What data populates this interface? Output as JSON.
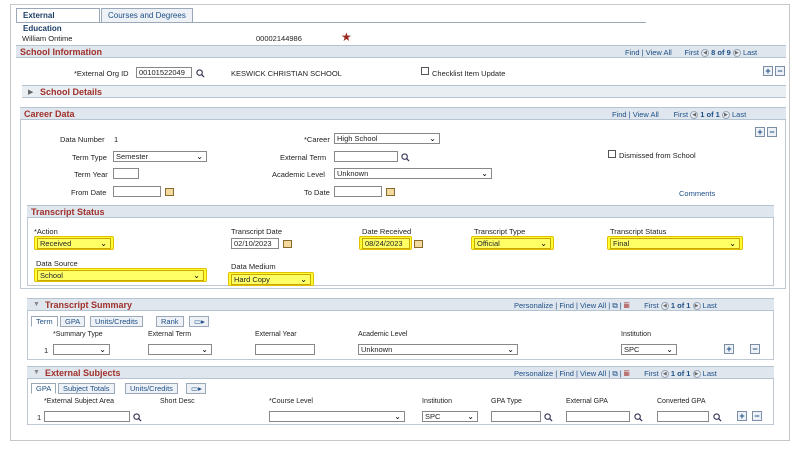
{
  "tabs": [
    {
      "label": "External Education",
      "active": true
    },
    {
      "label": "Courses and Degrees",
      "active": false
    }
  ],
  "person": {
    "name": "William Ontime",
    "id": "00002144986"
  },
  "school_info": {
    "title": "School Information",
    "nav": {
      "find": "Find",
      "view_all": "View All",
      "first": "First",
      "count": "8 of 9",
      "last": "Last"
    },
    "org_id_label": "*External Org ID",
    "org_id_value": "00101522049",
    "org_name": "KESWICK CHRISTIAN SCHOOL",
    "checklist_label": "Checklist Item Update",
    "details_label": "School Details"
  },
  "career": {
    "title": "Career Data",
    "nav": {
      "find": "Find",
      "view_all": "View All",
      "first": "First",
      "count": "1 of 1",
      "last": "Last"
    },
    "data_number_label": "Data Number",
    "data_number_value": "1",
    "career_label": "*Career",
    "career_value": "High School",
    "term_type_label": "Term Type",
    "term_type_value": "Semester",
    "external_term_label": "External Term",
    "dismissed_label": "Dismissed from School",
    "term_year_label": "Term Year",
    "academic_level_label": "Academic Level",
    "academic_level_value": "Unknown",
    "from_date_label": "From Date",
    "to_date_label": "To Date",
    "comments_label": "Comments"
  },
  "transcript_status": {
    "title": "Transcript Status",
    "action_label": "*Action",
    "action_value": "Received",
    "transcript_date_label": "Transcript Date",
    "transcript_date_value": "02/10/2023",
    "date_received_label": "Date Received",
    "date_received_value": "08/24/2023",
    "transcript_type_label": "Transcript Type",
    "transcript_type_value": "Official",
    "transcript_status_label": "Transcript Status",
    "transcript_status_value": "Final",
    "data_source_label": "Data Source",
    "data_source_value": "School",
    "data_medium_label": "Data Medium",
    "data_medium_value": "Hard Copy"
  },
  "transcript_summary": {
    "title": "Transcript Summary",
    "nav": {
      "personalize": "Personalize",
      "find": "Find",
      "view_all": "View All",
      "first": "First",
      "count": "1 of 1",
      "last": "Last"
    },
    "tabs": [
      "Term",
      "GPA",
      "Units/Credits",
      "Rank"
    ],
    "columns": [
      "*Summary Type",
      "External Term",
      "External Year",
      "Academic Level",
      "Institution"
    ],
    "row": {
      "num": "1",
      "academic_level": "Unknown",
      "institution": "SPC"
    }
  },
  "external_subjects": {
    "title": "External Subjects",
    "nav": {
      "personalize": "Personalize",
      "find": "Find",
      "view_all": "View All",
      "first": "First",
      "count": "1 of 1",
      "last": "Last"
    },
    "tabs": [
      "GPA",
      "Subject Totals",
      "Units/Credits"
    ],
    "columns": [
      "*External Subject Area",
      "Short Desc",
      "*Course Level",
      "Institution",
      "GPA Type",
      "External GPA",
      "Converted GPA"
    ],
    "row": {
      "num": "1",
      "institution": "SPC"
    }
  },
  "colors": {
    "accent": "#a0312b",
    "header_bg": "#dfe6ee",
    "highlight": "#ffff33",
    "link": "#1d4f86"
  }
}
